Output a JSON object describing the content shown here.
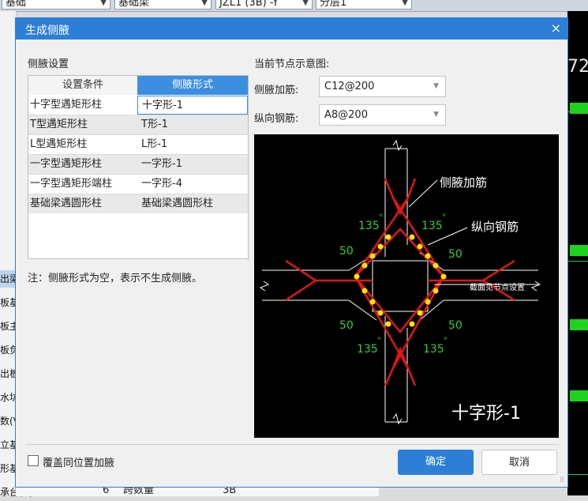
{
  "toolbar": {
    "combo1": "基础",
    "combo2": "基础梁",
    "combo3": "JZL1 (3B) -Y",
    "combo4": "分层1"
  },
  "left_panel": {
    "items": [
      "出梁",
      "板基",
      "板主",
      "板负",
      "出板",
      "水坑",
      "数(V",
      "立基",
      "形基",
      "承台(V)"
    ]
  },
  "bottom_row": {
    "index": "6",
    "name": "跨数量",
    "value": "3B"
  },
  "canvas": {
    "number": "72"
  },
  "dialog": {
    "title": "生成侧腋",
    "close_label": "×",
    "section_title": "侧腋设置",
    "table": {
      "headers": [
        "设置条件",
        "侧腋形式"
      ],
      "rows": [
        {
          "condition": "十字型遇矩形柱",
          "form": "十字形-1"
        },
        {
          "condition": "T型遇矩形柱",
          "form": "T形-1"
        },
        {
          "condition": "L型遇矩形柱",
          "form": "L形-1"
        },
        {
          "condition": "一字型遇矩形柱",
          "form": "一字形-1"
        },
        {
          "condition": "一字型遇矩形端柱",
          "form": "一字形-4"
        },
        {
          "condition": "基础梁遇圆形柱",
          "form": "基础梁遇圆形柱"
        }
      ]
    },
    "note": "注：侧腋形式为空，表示不生成侧腋。",
    "preview_title": "当前节点示意图:",
    "haunch_rebar_label": "侧腋加筋:",
    "haunch_rebar_value": "C12@200",
    "long_rebar_label": "纵向钢筋:",
    "long_rebar_value": "A8@200",
    "diagram": {
      "label_haunch": "侧腋加筋",
      "label_long": "纵向钢筋",
      "label_section": "截面见节点设置",
      "angle": "135",
      "degree": "°",
      "dim": "50",
      "caption": "十字形-1"
    },
    "overwrite_label": "覆盖同位置加腋",
    "ok_label": "确定",
    "cancel_label": "取消"
  }
}
